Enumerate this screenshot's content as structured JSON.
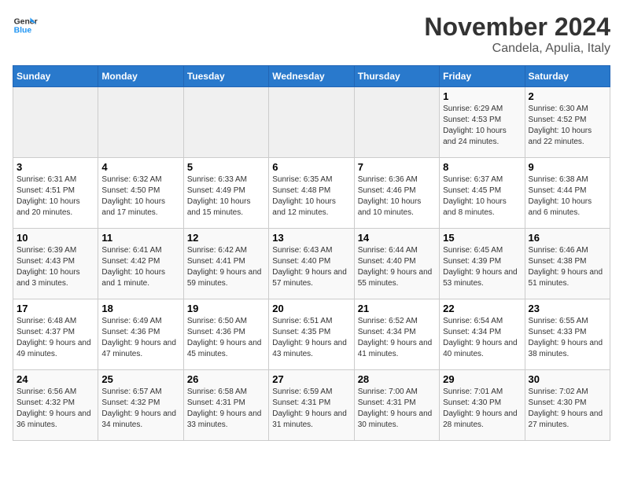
{
  "logo": {
    "line1": "General",
    "line2": "Blue"
  },
  "title": "November 2024",
  "subtitle": "Candela, Apulia, Italy",
  "weekdays": [
    "Sunday",
    "Monday",
    "Tuesday",
    "Wednesday",
    "Thursday",
    "Friday",
    "Saturday"
  ],
  "weeks": [
    [
      {
        "day": "",
        "info": ""
      },
      {
        "day": "",
        "info": ""
      },
      {
        "day": "",
        "info": ""
      },
      {
        "day": "",
        "info": ""
      },
      {
        "day": "",
        "info": ""
      },
      {
        "day": "1",
        "info": "Sunrise: 6:29 AM\nSunset: 4:53 PM\nDaylight: 10 hours and 24 minutes."
      },
      {
        "day": "2",
        "info": "Sunrise: 6:30 AM\nSunset: 4:52 PM\nDaylight: 10 hours and 22 minutes."
      }
    ],
    [
      {
        "day": "3",
        "info": "Sunrise: 6:31 AM\nSunset: 4:51 PM\nDaylight: 10 hours and 20 minutes."
      },
      {
        "day": "4",
        "info": "Sunrise: 6:32 AM\nSunset: 4:50 PM\nDaylight: 10 hours and 17 minutes."
      },
      {
        "day": "5",
        "info": "Sunrise: 6:33 AM\nSunset: 4:49 PM\nDaylight: 10 hours and 15 minutes."
      },
      {
        "day": "6",
        "info": "Sunrise: 6:35 AM\nSunset: 4:48 PM\nDaylight: 10 hours and 12 minutes."
      },
      {
        "day": "7",
        "info": "Sunrise: 6:36 AM\nSunset: 4:46 PM\nDaylight: 10 hours and 10 minutes."
      },
      {
        "day": "8",
        "info": "Sunrise: 6:37 AM\nSunset: 4:45 PM\nDaylight: 10 hours and 8 minutes."
      },
      {
        "day": "9",
        "info": "Sunrise: 6:38 AM\nSunset: 4:44 PM\nDaylight: 10 hours and 6 minutes."
      }
    ],
    [
      {
        "day": "10",
        "info": "Sunrise: 6:39 AM\nSunset: 4:43 PM\nDaylight: 10 hours and 3 minutes."
      },
      {
        "day": "11",
        "info": "Sunrise: 6:41 AM\nSunset: 4:42 PM\nDaylight: 10 hours and 1 minute."
      },
      {
        "day": "12",
        "info": "Sunrise: 6:42 AM\nSunset: 4:41 PM\nDaylight: 9 hours and 59 minutes."
      },
      {
        "day": "13",
        "info": "Sunrise: 6:43 AM\nSunset: 4:40 PM\nDaylight: 9 hours and 57 minutes."
      },
      {
        "day": "14",
        "info": "Sunrise: 6:44 AM\nSunset: 4:40 PM\nDaylight: 9 hours and 55 minutes."
      },
      {
        "day": "15",
        "info": "Sunrise: 6:45 AM\nSunset: 4:39 PM\nDaylight: 9 hours and 53 minutes."
      },
      {
        "day": "16",
        "info": "Sunrise: 6:46 AM\nSunset: 4:38 PM\nDaylight: 9 hours and 51 minutes."
      }
    ],
    [
      {
        "day": "17",
        "info": "Sunrise: 6:48 AM\nSunset: 4:37 PM\nDaylight: 9 hours and 49 minutes."
      },
      {
        "day": "18",
        "info": "Sunrise: 6:49 AM\nSunset: 4:36 PM\nDaylight: 9 hours and 47 minutes."
      },
      {
        "day": "19",
        "info": "Sunrise: 6:50 AM\nSunset: 4:36 PM\nDaylight: 9 hours and 45 minutes."
      },
      {
        "day": "20",
        "info": "Sunrise: 6:51 AM\nSunset: 4:35 PM\nDaylight: 9 hours and 43 minutes."
      },
      {
        "day": "21",
        "info": "Sunrise: 6:52 AM\nSunset: 4:34 PM\nDaylight: 9 hours and 41 minutes."
      },
      {
        "day": "22",
        "info": "Sunrise: 6:54 AM\nSunset: 4:34 PM\nDaylight: 9 hours and 40 minutes."
      },
      {
        "day": "23",
        "info": "Sunrise: 6:55 AM\nSunset: 4:33 PM\nDaylight: 9 hours and 38 minutes."
      }
    ],
    [
      {
        "day": "24",
        "info": "Sunrise: 6:56 AM\nSunset: 4:32 PM\nDaylight: 9 hours and 36 minutes."
      },
      {
        "day": "25",
        "info": "Sunrise: 6:57 AM\nSunset: 4:32 PM\nDaylight: 9 hours and 34 minutes."
      },
      {
        "day": "26",
        "info": "Sunrise: 6:58 AM\nSunset: 4:31 PM\nDaylight: 9 hours and 33 minutes."
      },
      {
        "day": "27",
        "info": "Sunrise: 6:59 AM\nSunset: 4:31 PM\nDaylight: 9 hours and 31 minutes."
      },
      {
        "day": "28",
        "info": "Sunrise: 7:00 AM\nSunset: 4:31 PM\nDaylight: 9 hours and 30 minutes."
      },
      {
        "day": "29",
        "info": "Sunrise: 7:01 AM\nSunset: 4:30 PM\nDaylight: 9 hours and 28 minutes."
      },
      {
        "day": "30",
        "info": "Sunrise: 7:02 AM\nSunset: 4:30 PM\nDaylight: 9 hours and 27 minutes."
      }
    ]
  ]
}
